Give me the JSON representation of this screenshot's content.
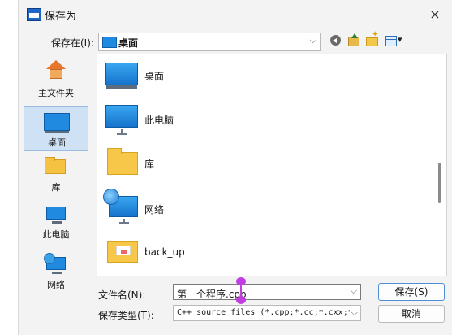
{
  "dialog": {
    "title": "保存为",
    "close_glyph": "×"
  },
  "location": {
    "label": "保存在(I):",
    "value": "桌面"
  },
  "places": [
    {
      "label": "主文件夹",
      "icon": "home-icon"
    },
    {
      "label": "桌面",
      "icon": "desktop-icon",
      "selected": true
    },
    {
      "label": "库",
      "icon": "library-icon"
    },
    {
      "label": "此电脑",
      "icon": "computer-icon"
    },
    {
      "label": "网络",
      "icon": "network-icon"
    }
  ],
  "files": [
    {
      "label": "桌面",
      "icon": "desktop-icon"
    },
    {
      "label": "此电脑",
      "icon": "computer-icon"
    },
    {
      "label": "库",
      "icon": "library-icon"
    },
    {
      "label": "网络",
      "icon": "network-icon"
    },
    {
      "label": "back_up",
      "icon": "folder-icon"
    }
  ],
  "filename": {
    "label": "文件名(N):",
    "value": "第一个程序.cpp"
  },
  "filetype": {
    "label": "保存类型(T):",
    "value": "C++ source files (*.cpp;*.cc;*.cxx;*."
  },
  "buttons": {
    "save": "保存(S)",
    "cancel": "取消"
  },
  "colors": {
    "accent": "#1f8ae0",
    "selection": "#cfe1f5",
    "caret_marker": "#c23ee0"
  }
}
